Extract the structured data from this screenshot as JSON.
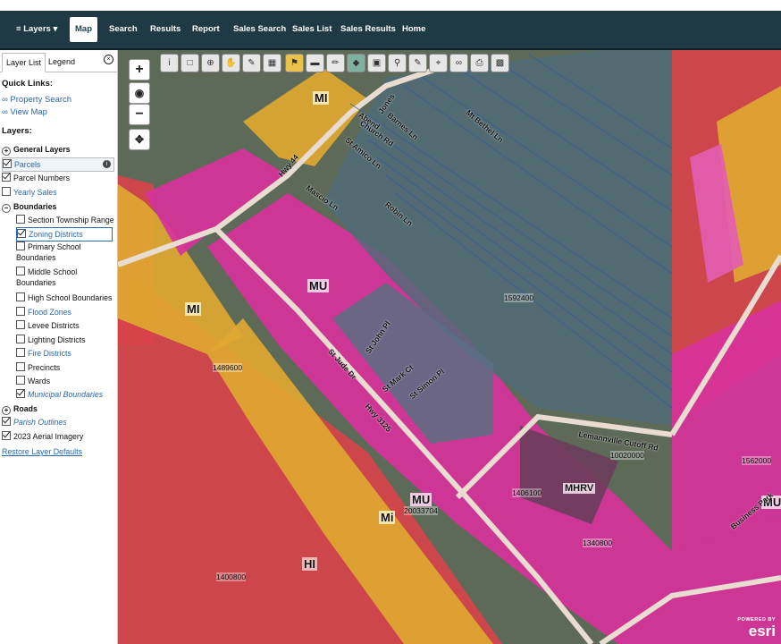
{
  "nav": {
    "layers": "Layers",
    "items": [
      "Map",
      "Search",
      "Results",
      "Report",
      "Sales Search",
      "Sales List",
      "Sales Results",
      "Home"
    ]
  },
  "sidebar": {
    "tab_layer_list": "Layer List",
    "tab_legend": "Legend",
    "quick_links_title": "Quick Links:",
    "quick_links": [
      "Property Search",
      "View Map"
    ],
    "layers_title": "Layers:",
    "general_layers": "General Layers",
    "parcels": "Parcels",
    "parcel_numbers": "Parcel Numbers",
    "yearly_sales": "Yearly Sales",
    "boundaries": "Boundaries",
    "section_township_range": "Section Township Range",
    "zoning_districts": "Zoning Districts",
    "primary_school": "Primary School Boundaries",
    "middle_school": "Middle School Boundaries",
    "high_school": "High School Boundaries",
    "flood_zones": "Flood Zones",
    "levee_districts": "Levee Districts",
    "lighting_districts": "Lighting Districts",
    "fire_districts": "Fire Districts",
    "precincts": "Precincts",
    "wards": "Wards",
    "municipal_boundaries": "Municipal Boundaries",
    "roads": "Roads",
    "parish_outlines": "Parish Outlines",
    "aerial": "2023 Aerial Imagery",
    "restore": "Restore Layer Defaults"
  },
  "map": {
    "zone_labels": {
      "mi_top": "MI",
      "mi_left": "MI",
      "mu_center": "MU",
      "mu_bottom": "MU",
      "mi_bottom": "Mi",
      "hi": "HI",
      "mhrv": "MHRV",
      "mu_right": "MU"
    },
    "parcel_ids": {
      "p1": "1592400",
      "p2": "1489600",
      "p3": "10020000",
      "p4": "1562000",
      "p5": "1406100",
      "p6": "20033704",
      "p7": "1340800",
      "p8": "1400800"
    },
    "roads": {
      "jones": "Jones",
      "barnes": "Barnes Ln",
      "mt_bethel": "Mt Bethel Ln",
      "abend": "Abend",
      "church": "Church Rd",
      "amico": "St Amico Ln",
      "hwy44": "Hwy 44",
      "robin": "Robin Ln",
      "mascio": "Mascio Ln",
      "john": "St John Pl",
      "mark": "St Mark Ct",
      "simon": "St Simon Pl",
      "jude": "St Jude Dr",
      "hwy3125": "Hwy 3125",
      "lemann": "Lemannville Cutoff Rd",
      "business": "Business Park"
    },
    "esri_powered": "POWERED BY",
    "esri": "esri"
  }
}
